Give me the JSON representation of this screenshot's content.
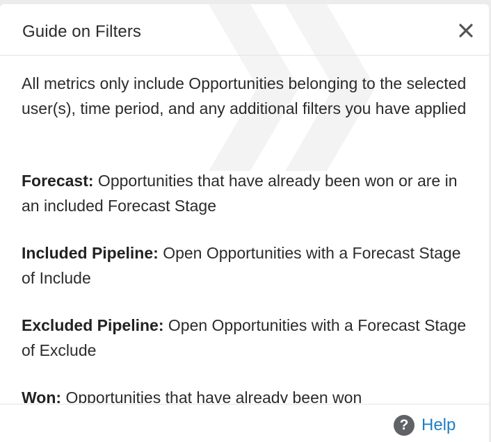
{
  "dialog": {
    "title": "Guide on Filters",
    "close_icon": "close-icon",
    "intro": "All metrics only include Opportunities belonging to the selected user(s), time period, and any additional filters you have applied",
    "definitions": [
      {
        "term": "Forecast:",
        "text": " Opportunities that have already been won or are in an included Forecast Stage"
      },
      {
        "term": "Included Pipeline:",
        "text": " Open Opportunities with a Forecast Stage of Include"
      },
      {
        "term": "Excluded Pipeline:",
        "text": " Open Opportunities with a Forecast Stage of Exclude"
      },
      {
        "term": "Won:",
        "text": " Opportunities that have already been won"
      }
    ],
    "footer": {
      "help_icon": "question-circle-icon",
      "help_icon_glyph": "?",
      "help_label": "Help"
    }
  },
  "colors": {
    "link": "#1e7fc4",
    "text": "#2b2b2b",
    "divider": "#e3e3e3",
    "help_icon_bg": "#5f6368"
  }
}
